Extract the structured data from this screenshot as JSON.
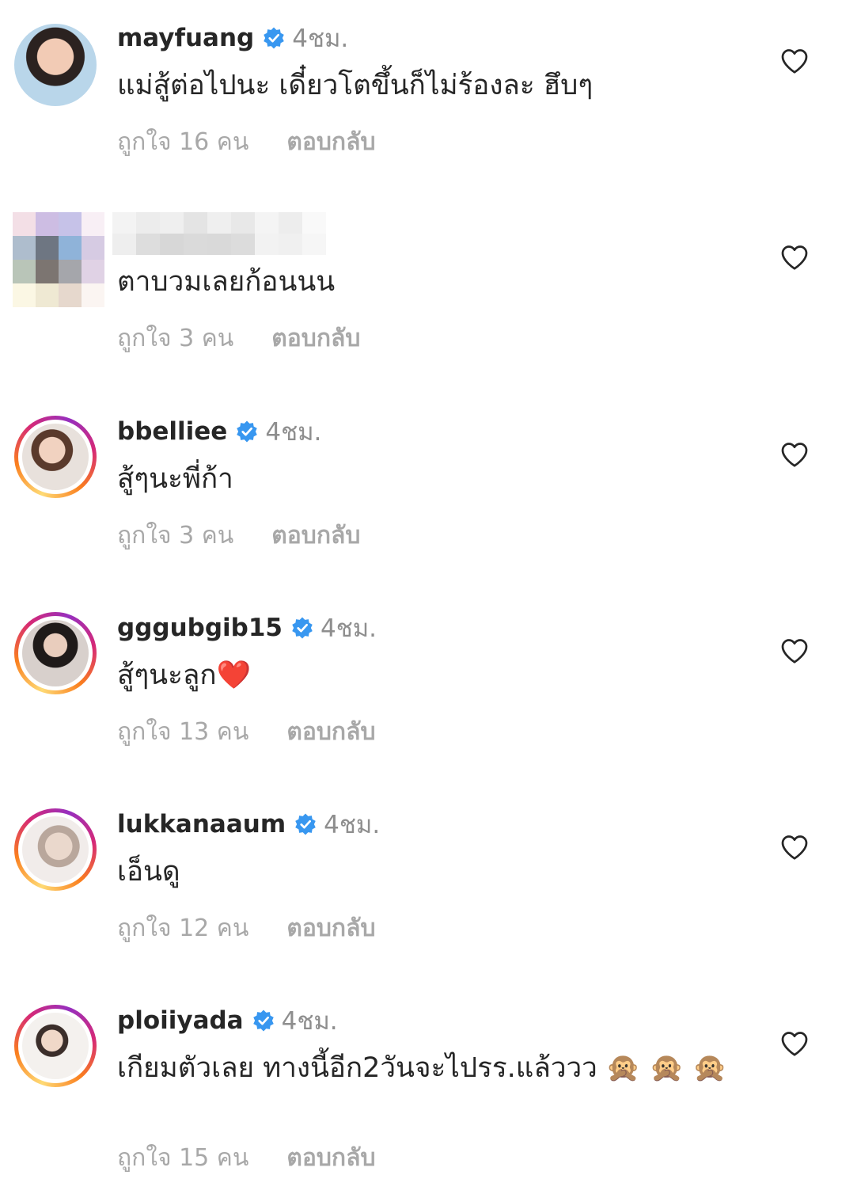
{
  "comments": [
    {
      "username": "mayfuang",
      "verified": true,
      "time": "4ชม.",
      "text": "แม่สู้ต่อไปนะ เดี๋ยวโตขึ้นก็ไม่ร้องละ ฮึบๆ",
      "likes": "ถูกใจ 16 คน",
      "reply": "ตอบกลับ",
      "avatar": "portrait-photo"
    },
    {
      "username": "",
      "verified": false,
      "time": "",
      "text": "ตาบวมเลยก้อนนน",
      "likes": "ถูกใจ 3 คน",
      "reply": "ตอบกลับ",
      "avatar": "pixelated"
    },
    {
      "username": "bbelliee",
      "verified": true,
      "time": "4ชม.",
      "text": "สู้ๆนะพี่ก้า",
      "likes": "ถูกใจ 3 คน",
      "reply": "ตอบกลับ",
      "avatar": "story-ring-photo"
    },
    {
      "username": "gggubgib15",
      "verified": true,
      "time": "4ชม.",
      "text": "สู้ๆนะลูก",
      "text_emoji": "❤️",
      "likes": "ถูกใจ 13 คน",
      "reply": "ตอบกลับ",
      "avatar": "story-ring-photo"
    },
    {
      "username": "lukkanaaum",
      "verified": true,
      "time": "4ชม.",
      "text": "เอ็นดู",
      "likes": "ถูกใจ 12 คน",
      "reply": "ตอบกลับ",
      "avatar": "story-ring-photo"
    },
    {
      "username": "ploiiyada",
      "verified": true,
      "time": "4ชม.",
      "text": "เกียมตัวเลย ทางนี้อีก2วันจะไปรร.แล้ววว",
      "text_emoji": "🙊 🙊 🙊",
      "likes": "ถูกใจ 15 คน",
      "reply": "ตอบกลับ",
      "avatar": "story-ring-photo"
    }
  ],
  "icons": {
    "verified": "verified-badge-icon",
    "like": "heart-outline-icon"
  },
  "colors": {
    "verified": "#3897f0",
    "muted": "#8e8e8e",
    "meta": "#a8a8a8",
    "text": "#262626"
  }
}
